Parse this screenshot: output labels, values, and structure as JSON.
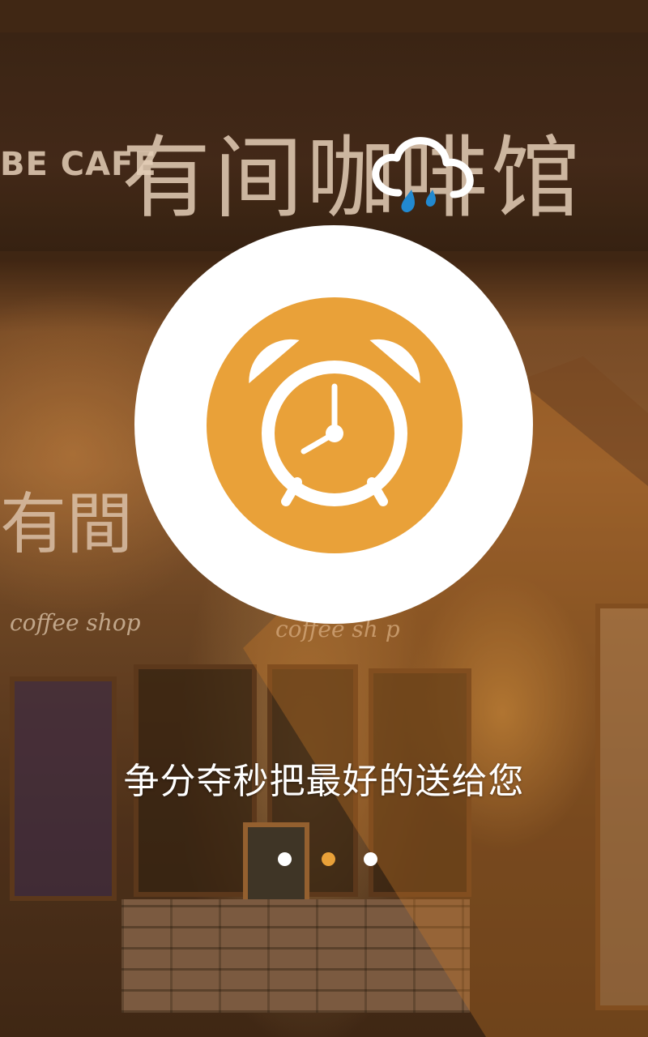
{
  "background": {
    "sign_logo_text": "BE CAFE",
    "sign_name_text": "有间咖啡馆",
    "window_sign_text": "有間",
    "shop_sign_left": "coffee  shop",
    "shop_sign_right": "coffee  sh p"
  },
  "weather": {
    "icon": "rain-cloud-icon"
  },
  "hero": {
    "icon": "alarm-clock-icon",
    "icon_color": "#e9a139"
  },
  "tagline": "争分夺秒把最好的送给您",
  "pager": {
    "total": 3,
    "active_index": 1,
    "active_color": "#e9a139",
    "inactive_color": "#ffffff"
  }
}
